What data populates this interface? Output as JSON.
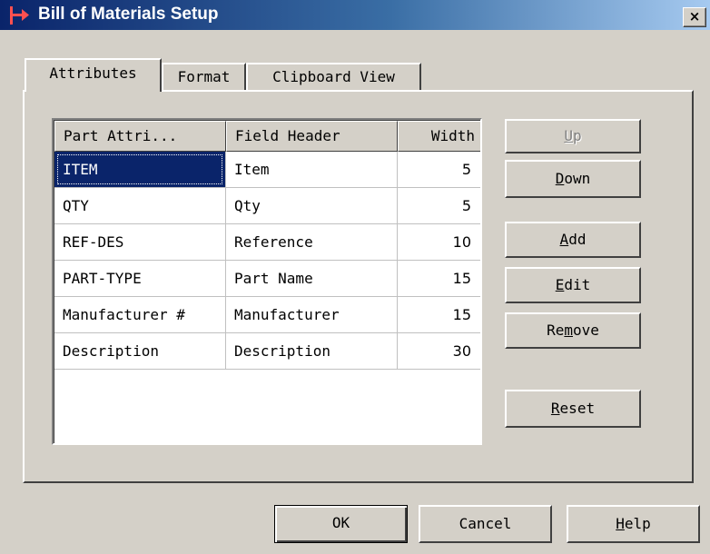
{
  "window": {
    "title": "Bill of Materials Setup",
    "close_glyph": "×"
  },
  "tabs": [
    {
      "label": "Attributes",
      "active": true
    },
    {
      "label": "Format",
      "active": false
    },
    {
      "label": "Clipboard View",
      "active": false
    }
  ],
  "table": {
    "columns": [
      "Part Attri...",
      "Field Header",
      "Width"
    ],
    "rows": [
      {
        "attribute": "ITEM",
        "header": "Item",
        "width": "5",
        "selected": true
      },
      {
        "attribute": "QTY",
        "header": "Qty",
        "width": "5",
        "selected": false
      },
      {
        "attribute": "REF-DES",
        "header": "Reference",
        "width": "10",
        "selected": false
      },
      {
        "attribute": "PART-TYPE",
        "header": "Part Name",
        "width": "15",
        "selected": false
      },
      {
        "attribute": "Manufacturer #",
        "header": "Manufacturer",
        "width": "15",
        "selected": false
      },
      {
        "attribute": "Description",
        "header": "Description",
        "width": "30",
        "selected": false
      }
    ]
  },
  "side_buttons": {
    "up": {
      "accel": "U",
      "rest": "p",
      "enabled": false
    },
    "down": {
      "accel": "D",
      "rest": "own",
      "enabled": true
    },
    "add": {
      "accel": "A",
      "rest": "dd",
      "enabled": true
    },
    "edit": {
      "accel": "E",
      "rest": "dit",
      "enabled": true
    },
    "remove": {
      "pre": "Re",
      "accel": "m",
      "rest": "ove",
      "enabled": true
    },
    "reset": {
      "accel": "R",
      "rest": "eset",
      "enabled": true
    }
  },
  "footer_buttons": {
    "ok": "OK",
    "cancel": "Cancel",
    "help": {
      "accel": "H",
      "rest": "elp"
    }
  },
  "colors": {
    "selection": "#0a246a",
    "face": "#d4d0c8",
    "title_gradient_start": "#0a246a",
    "title_gradient_end": "#a6caf0"
  }
}
